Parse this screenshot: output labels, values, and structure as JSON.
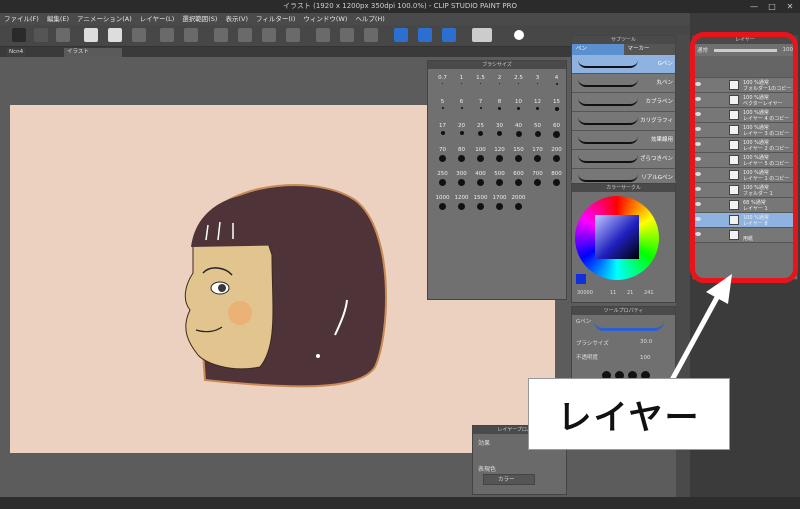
{
  "window": {
    "title": "イラスト (1920 x 1200px 350dpi 100.0%) - CLIP STUDIO PAINT PRO",
    "min": "—",
    "max": "□",
    "close": "✕"
  },
  "menu": [
    "ファイル(F)",
    "編集(E)",
    "アニメーション(A)",
    "レイヤー(L)",
    "選択範囲(S)",
    "表示(V)",
    "フィルター(I)",
    "ウィンドウ(W)",
    "ヘルプ(H)"
  ],
  "tabs": [
    "Ncn4",
    "イラスト"
  ],
  "brush_size_panel": {
    "title": "ブラシサイズ",
    "sizes": [
      "0.7",
      "1",
      "1.5",
      "2",
      "2.5",
      "3",
      "4",
      "5",
      "6",
      "7",
      "8",
      "10",
      "12",
      "15",
      "17",
      "20",
      "25",
      "30",
      "40",
      "50",
      "60",
      "70",
      "80",
      "100",
      "120",
      "150",
      "170",
      "200",
      "250",
      "300",
      "400",
      "500",
      "600",
      "700",
      "800",
      "1000",
      "1200",
      "1500",
      "1700",
      "2000"
    ],
    "dot_diameters": [
      1,
      1,
      1,
      1,
      1,
      1,
      2,
      2,
      2,
      2,
      3,
      3,
      3,
      4,
      4,
      4,
      5,
      5,
      6,
      6,
      7,
      7,
      7,
      7,
      7,
      7,
      7,
      7,
      7,
      7,
      7,
      7,
      7,
      7,
      7,
      7,
      7,
      7,
      7,
      7
    ]
  },
  "subtool_panel": {
    "title": "サブツール",
    "tabs": [
      "ペン",
      "マーカー"
    ],
    "items": [
      "Gペン",
      "丸ペン",
      "カブラペン",
      "カリグラフィ",
      "効果線用",
      "ざらつきペン",
      "リアルGペン"
    ]
  },
  "color_panel": {
    "title": "カラーサークル",
    "values": [
      "11",
      "21",
      "241"
    ],
    "extra": "30000"
  },
  "tool_property": {
    "title": "ツールプロパティ",
    "tool": "Gペン",
    "size_label": "ブラシサイズ",
    "size_value": "30.0",
    "opacity_label": "不透明度",
    "opacity_value": "100"
  },
  "layer_property": {
    "title": "レイヤープロパティ",
    "effect_label": "効果",
    "color_label": "表現色",
    "color_value": "カラー"
  },
  "layer_panel": {
    "title": "レイヤー",
    "blend": "通常",
    "opacity": "100",
    "layers": [
      {
        "line1": "100 %通常",
        "line2": "フォルダー1のコピー"
      },
      {
        "line1": "100 %通常",
        "line2": "ベクターレイヤー"
      },
      {
        "line1": "100 %通常",
        "line2": "レイヤー 4 のコピー"
      },
      {
        "line1": "100 %通常",
        "line2": "レイヤー 3 のコピー"
      },
      {
        "line1": "100 %通常",
        "line2": "レイヤー 2 のコピー"
      },
      {
        "line1": "100 %通常",
        "line2": "レイヤー 5 のコピー"
      },
      {
        "line1": "100 %通常",
        "line2": "レイヤー 1 のコピー"
      },
      {
        "line1": "100 %通常",
        "line2": "フォルダー 1"
      },
      {
        "line1": "68 %通常",
        "line2": "レイヤー 1"
      },
      {
        "line1": "100 %通常",
        "line2": "レイヤー 8"
      },
      {
        "line1": "",
        "line2": "用紙"
      }
    ]
  },
  "callout": {
    "text": "レイヤー"
  },
  "colors": {
    "highlight": "#e8141b",
    "canvas": "#ecd0c0",
    "hair": "#4e3338",
    "skin": "#e1c48e"
  }
}
